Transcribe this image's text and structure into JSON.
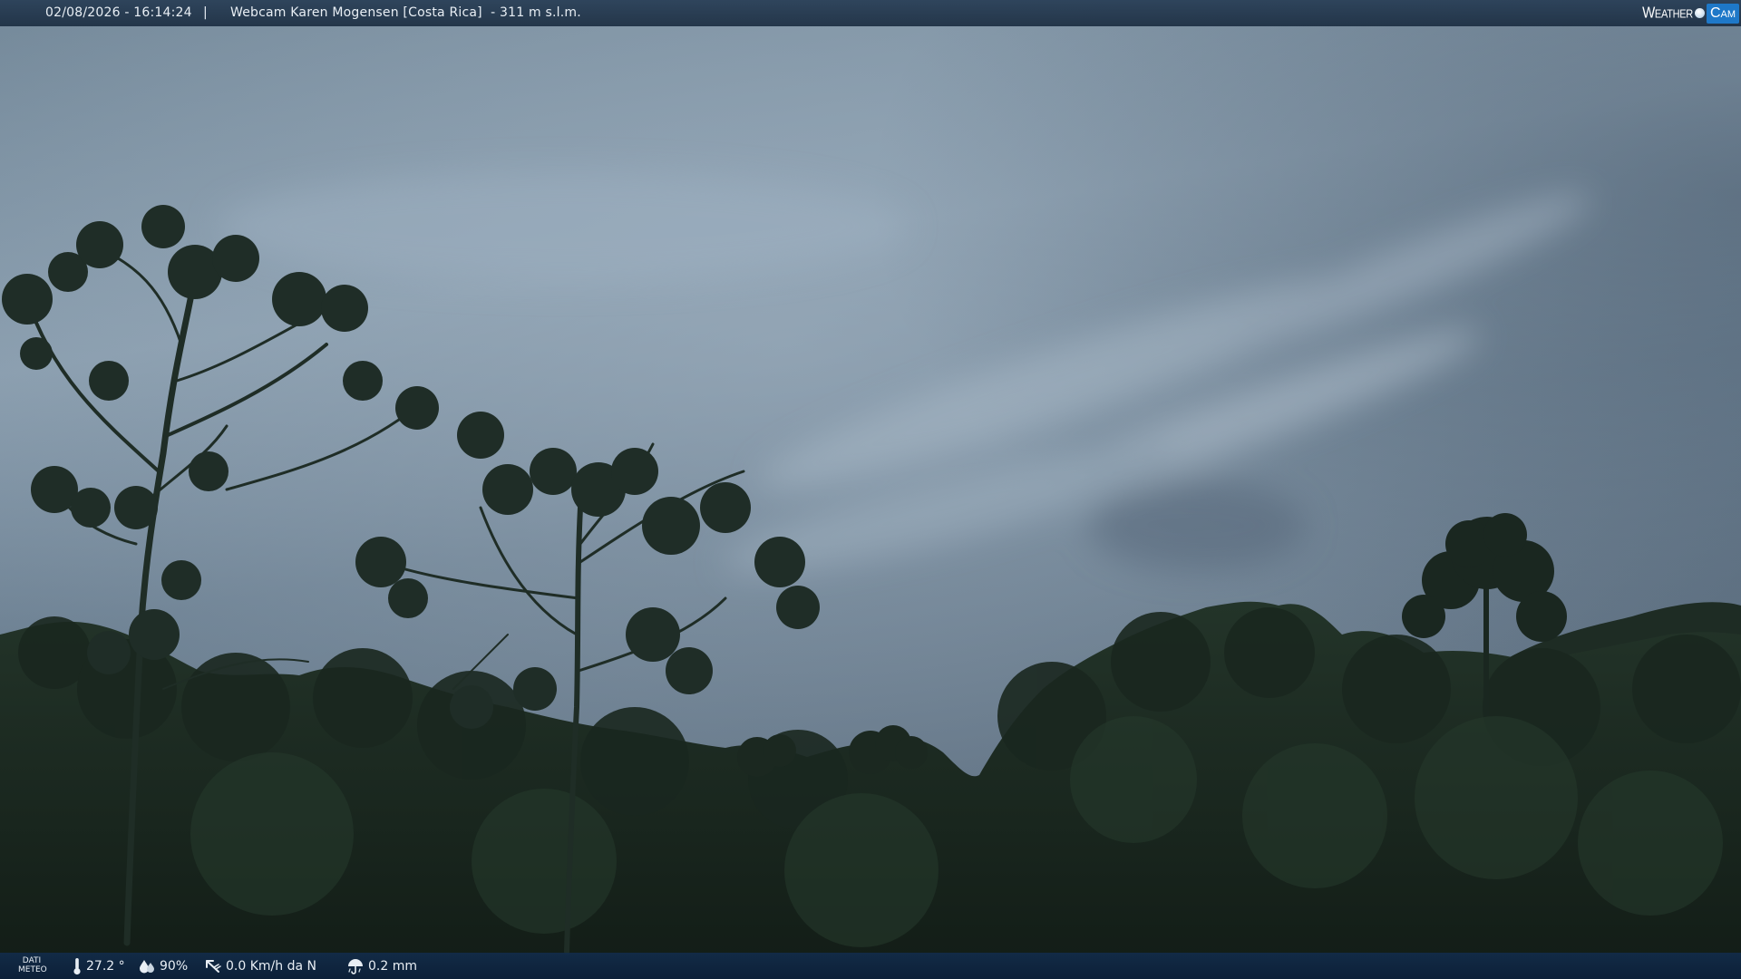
{
  "header": {
    "datetime": "02/08/2026 - 16:14:24",
    "separator": "|",
    "title": "Webcam Karen Mogensen [Costa Rica]  - 311 m s.l.m."
  },
  "logo": {
    "weather_text": "Weather",
    "cam_text": "Cam"
  },
  "footer": {
    "meteo_label_line1": "DATI",
    "meteo_label_line2": "METEO",
    "temperature": "27.2 °",
    "humidity": "90%",
    "wind": "0.0 Km/h da N",
    "rain": "0.2 mm"
  },
  "icons": {
    "temperature": "thermometer-icon",
    "humidity": "humidity-drops-icon",
    "wind": "wind-direction-icon",
    "rain": "rain-umbrella-icon"
  },
  "colors": {
    "sky_top": "#6e8294",
    "sky_mid": "#8ea1b2",
    "foliage": "#1b2920",
    "topbar": "#283e56",
    "bottombar": "#12304c",
    "logo_accent": "#1e78c8"
  }
}
